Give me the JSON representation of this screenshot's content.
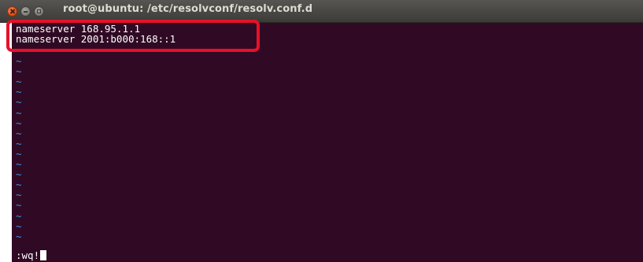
{
  "window": {
    "title": "root@ubuntu: /etc/resolvconf/resolv.conf.d",
    "controls": {
      "close_icon": "close-icon",
      "minimize_icon": "minimize-icon",
      "maximize_icon": "maximize-icon"
    }
  },
  "editor": {
    "lines": [
      "nameserver 168.95.1.1",
      "nameserver 2001:b000:168::1"
    ],
    "empty_line_marker": "~",
    "empty_line_count": 18,
    "command": ":wq!"
  },
  "annotation": {
    "color": "#e8102a"
  },
  "colors": {
    "terminal_background": "#300a24",
    "titlebar": "#3c3b37",
    "text": "#ffffff",
    "tilde": "#3f8fe0"
  }
}
